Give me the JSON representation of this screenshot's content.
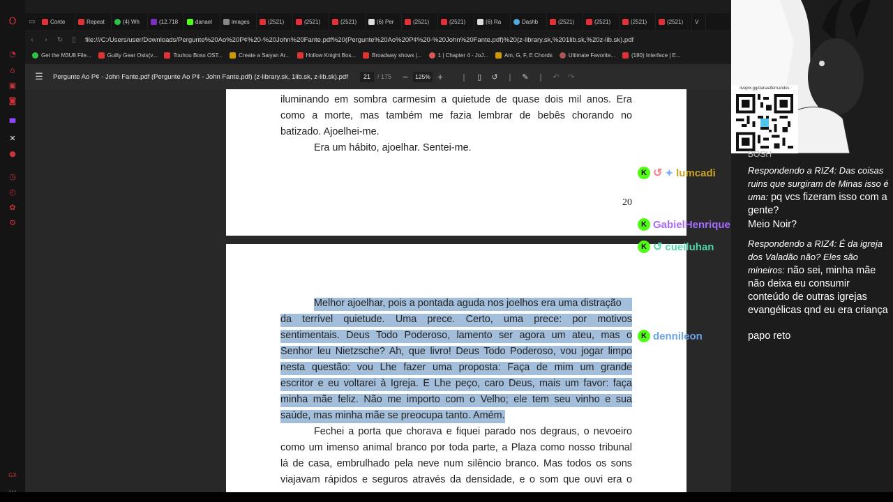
{
  "tabs": [
    {
      "label": "Conte",
      "color": "#e0303a"
    },
    {
      "label": "Repeat",
      "color": "#d33"
    },
    {
      "label": "(4) Wh",
      "color": "#2fc24a"
    },
    {
      "label": "(12.718",
      "color": "#7b2fbf"
    },
    {
      "label": "danael",
      "color": "#53fc18"
    },
    {
      "label": "images",
      "color": "#888"
    },
    {
      "label": "(2521)",
      "color": "#e0303a"
    },
    {
      "label": "(2521)",
      "color": "#e0303a"
    },
    {
      "label": "(2521)",
      "color": "#e0303a"
    },
    {
      "label": "(6) Per",
      "color": "#ddd"
    },
    {
      "label": "(2521)",
      "color": "#e0303a"
    },
    {
      "label": "(2521)",
      "color": "#e0303a"
    },
    {
      "label": "(6) Ra",
      "color": "#ddd"
    },
    {
      "label": "Dashb",
      "color": "#5ad"
    },
    {
      "label": "(2521)",
      "color": "#e0303a"
    },
    {
      "label": "(2521)",
      "color": "#e0303a"
    },
    {
      "label": "(2521)",
      "color": "#e0303a"
    },
    {
      "label": "(2521)",
      "color": "#e0303a"
    },
    {
      "label": "V",
      "color": "#ddd"
    }
  ],
  "address": {
    "url": "file:///C:/Users/user/Downloads/Pergunte%20Ao%20P¢%20-%20John%20Fante.pdf%20(Pergunte%20Ao%20P¢%20-%20John%20Fante.pdf)%20(z-library.sk,%201lib.sk,%20z-lib.sk).pdf"
  },
  "bookmarks": [
    {
      "label": "Get the M3U8 File...",
      "color": "#2fc24a"
    },
    {
      "label": "Guilty Gear Osts(v...",
      "color": "#d33"
    },
    {
      "label": "Touhou Boss OST...",
      "color": "#d33"
    },
    {
      "label": "Create a Saiyan Ar...",
      "color": "#c90"
    },
    {
      "label": "Hollow Knight Bos...",
      "color": "#d33"
    },
    {
      "label": "Broadway shows |...",
      "color": "#d33"
    },
    {
      "label": "1 | Chapter 4 - JoJ...",
      "color": "#d55"
    },
    {
      "label": "Am, G, F, E Chords",
      "color": "#c90"
    },
    {
      "label": "Ultimate Favorite...",
      "color": "#a55"
    },
    {
      "label": "(180) Interface | E...",
      "color": "#e0303a"
    }
  ],
  "pdf": {
    "title": "Pergunte Ao P¢ - John Fante.pdf (Pergunte Ao P¢ - John Fante.pdf) (z-library.sk, 1lib.sk, z-lib.sk).pdf",
    "current_page": "21",
    "total_pages": "/ 175",
    "zoom": "125%",
    "page_number": "20",
    "page1_lines": [
      "iluminando em sombra carmesim a quietude de quase dois mil anos. Era",
      "como a morte, mas também me fazia lembrar de bebês chorando no",
      "batizado. Ajoelhei-me.",
      "Era um hábito, ajoelhar. Sentei-me."
    ],
    "page2_lines": [
      "Melhor ajoelhar, pois a pontada aguda nos joelhos era uma distração",
      "da terrível quietude. Uma prece. Certo, uma prece: por motivos",
      "sentimentais. Deus Todo Poderoso, lamento ser agora um ateu, mas o",
      "Senhor leu Nietzsche? Ah, que livro! Deus Todo Poderoso, vou jogar limpo",
      "nesta questão: vou Lhe fazer uma proposta: Faça de mim um grande",
      "escritor e eu voltarei à Igreja. E Lhe peço, caro Deus, mais um favor: faça",
      "minha mãe feliz. Não me importo com o Velho; ele tem seu vinho e sua",
      "saúde, mas minha mãe se preocupa tanto. Amém.",
      "Fechei a porta que chorava e fiquei parado nos degraus, o nevoeiro",
      "como um imenso animal branco por toda parte, a Plaza como nosso tribunal",
      "lá de casa, embrulhado pela neve num silêncio branco. Mas todos os sons",
      "viajavam rápidos e seguros através da densidade, e o som que ouvi era o"
    ]
  },
  "overlay": {
    "qr_label": "livepix.gg/danaelfernandes",
    "chat": [
      {
        "user": "lumcadi",
        "user_color": "#c9a227",
        "reply": "Respondendo a RIZ4: Das coisas ruins que surgiram de Minas isso é uma:",
        "text": "pq vcs fizeram isso com a gente?"
      },
      {
        "user": "GabielHenrique",
        "user_color": "#a66bff",
        "reply": "",
        "text": "Meio Noir?"
      },
      {
        "user": "cueiluhan",
        "user_color": "#4fd6a8",
        "reply": "Respondendo a RIZ4: É da igreja dos Valadão não? Eles são mineiros:",
        "text": "não sei, minha mãe não deixa eu consumir conteúdo de outras igrejas evangélicas qnd eu era criança"
      },
      {
        "user": "dennileon",
        "user_color": "#6aa3e8",
        "reply": "",
        "text": "papo reto"
      }
    ],
    "partial_top_text": "BOSH"
  }
}
